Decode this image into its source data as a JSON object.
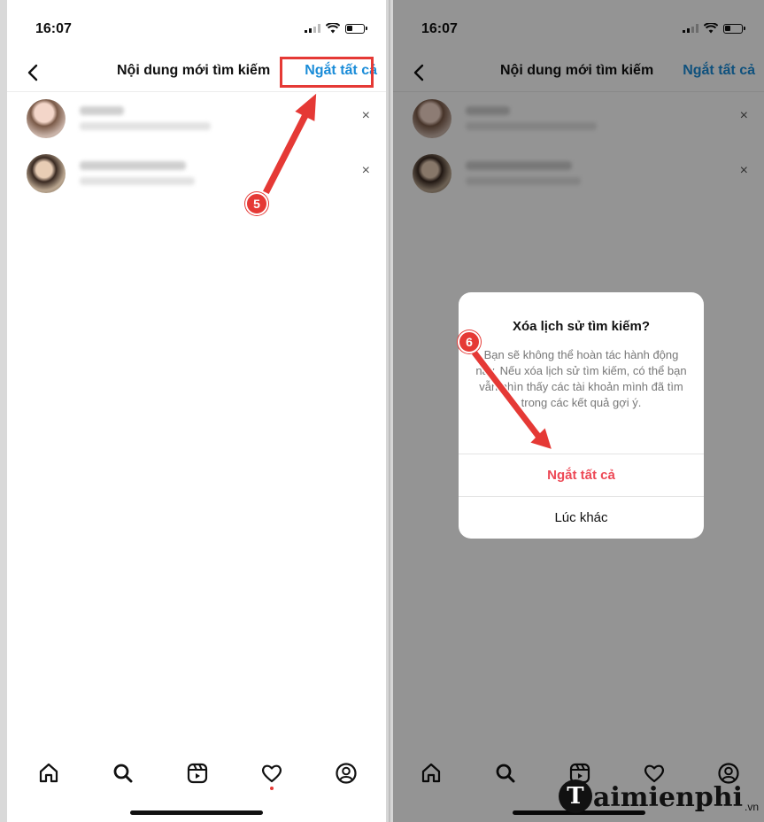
{
  "left_screen": {
    "status": {
      "time": "16:07"
    },
    "header": {
      "title": "Nội dung mới tìm kiếm",
      "action": "Ngắt tất cả"
    },
    "history": [
      {
        "close": "×"
      },
      {
        "close": "×"
      }
    ]
  },
  "right_screen": {
    "status": {
      "time": "16:07"
    },
    "header": {
      "title": "Nội dung mới tìm kiếm",
      "action": "Ngắt tất cả"
    },
    "history": [
      {
        "close": "×"
      },
      {
        "close": "×"
      }
    ],
    "dialog": {
      "title": "Xóa lịch sử tìm kiếm?",
      "body": "Bạn sẽ không thể hoàn tác hành động này. Nếu xóa lịch sử tìm kiếm, có thể bạn vẫn nhìn thấy các tài khoản mình đã tìm trong các kết quả gợi ý.",
      "confirm": "Ngắt tất cả",
      "cancel": "Lúc khác"
    }
  },
  "steps": {
    "step1": "5",
    "step2": "6"
  },
  "tabs": [
    "home-icon",
    "search-icon",
    "reels-icon",
    "heart-icon",
    "profile-icon"
  ],
  "watermark": {
    "logo": "T",
    "brand": "aimienphi",
    "tld": ".vn"
  },
  "colors": {
    "link": "#1a8cd8",
    "danger": "#ed4956",
    "annotation": "#e53935"
  }
}
